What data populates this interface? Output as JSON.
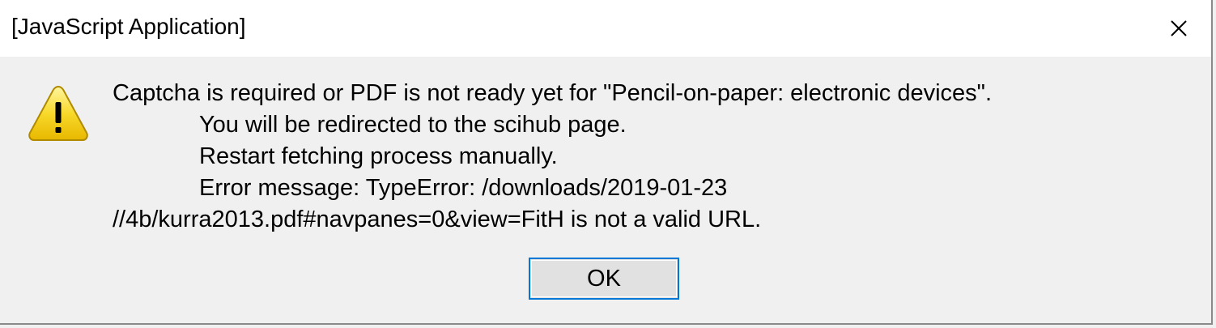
{
  "window": {
    "title": "[JavaScript Application]",
    "close_icon": "close-icon"
  },
  "dialog": {
    "icon": "warning-icon",
    "message_lines": [
      "Captcha is required or PDF is not ready yet for \"Pencil-on-paper: electronic devices\".",
      "You will be redirected to the scihub page.",
      "Restart fetching process manually.",
      "Error message: TypeError: /downloads/2019-01-23",
      "//4b/kurra2013.pdf#navpanes=0&view=FitH is not a valid URL."
    ],
    "ok_label": "OK"
  },
  "colors": {
    "title_bar": "#ffffff",
    "body": "#f0f0f0",
    "button_focus_border": "#0078d7",
    "warning_yellow": "#f5d000"
  }
}
